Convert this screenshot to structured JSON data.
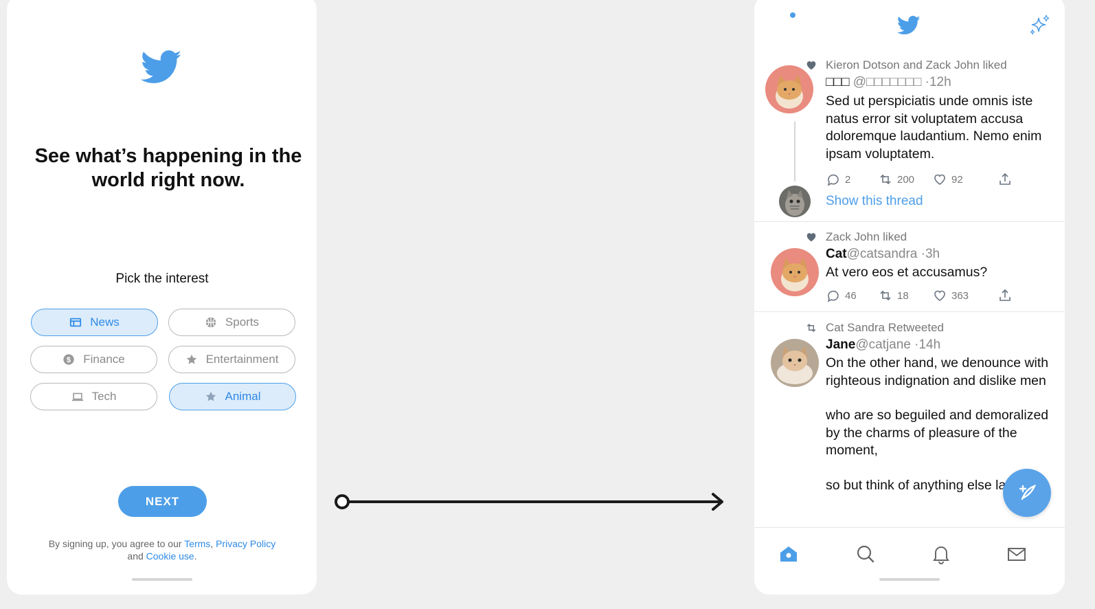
{
  "onboarding": {
    "headline": "See what’s happening in the world right now.",
    "pick_label": "Pick the interest",
    "chips": [
      {
        "label": "News",
        "icon": "news-icon",
        "selected": true
      },
      {
        "label": "Sports",
        "icon": "basketball-icon",
        "selected": false
      },
      {
        "label": "Finance",
        "icon": "dollar-icon",
        "selected": false
      },
      {
        "label": "Entertainment",
        "icon": "star-icon",
        "selected": false
      },
      {
        "label": "Tech",
        "icon": "laptop-icon",
        "selected": false
      },
      {
        "label": "Animal",
        "icon": "star-icon",
        "selected": true
      }
    ],
    "next_label": "NEXT",
    "terms": {
      "prefix": "By signing up, you agree to our ",
      "terms_link": "Terms",
      "sep": ", ",
      "privacy_link": "Privacy Policy",
      "and": " and ",
      "cookie_link": "Cookie use",
      "suffix": "."
    }
  },
  "colors": {
    "accent": "#4d9ee8",
    "chip_selected_bg": "#dcecfb",
    "background": "#efefef"
  },
  "feed": {
    "tweets": [
      {
        "context": "Kieron Dotson and Zack John liked",
        "context_icon": "heart-icon",
        "name": "□□□",
        "handle": "@□□□□□□□",
        "time": "·12h",
        "text": "Sed ut perspiciatis unde omnis iste natus error sit voluptatem accusa doloremque laudantium. Nemo enim ipsam voluptatem.",
        "replies": "2",
        "retweets": "200",
        "likes": "92",
        "show_thread": "Show this thread"
      },
      {
        "context": "Zack John liked",
        "context_icon": "heart-icon",
        "name": "Cat",
        "handle": "@catsandra",
        "time": " ·3h",
        "text": "At vero eos et accusamus?",
        "replies": "46",
        "retweets": "18",
        "likes": "363"
      },
      {
        "context": "Cat Sandra  Retweeted",
        "context_icon": "retweet-icon",
        "name": "Jane",
        "handle": "@catjane",
        "time": " ·14h",
        "text_p1": "On the other hand, we denounce with righteous indignation and dislike men",
        "text_p2": "who are so beguiled and demoralized by the charms of pleasure of the moment,",
        "text_p3": "so but think of anything else lately."
      }
    ]
  },
  "tabbar": [
    "home-icon",
    "search-icon",
    "bell-icon",
    "mail-icon"
  ]
}
